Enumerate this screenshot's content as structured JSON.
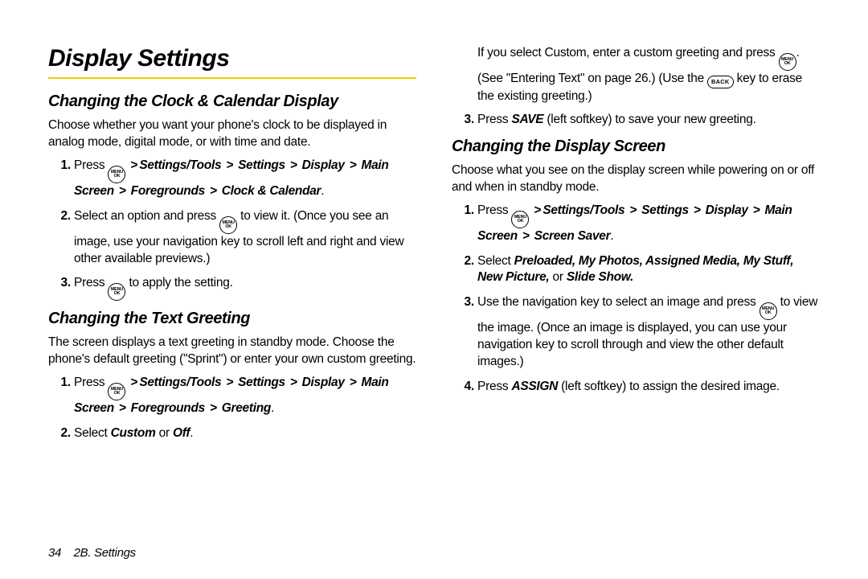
{
  "h1": "Display Settings",
  "sec1": {
    "title": "Changing the Clock & Calendar Display",
    "intro": "Choose whether you want your phone's clock to be displayed in analog mode, digital mode, or with time and date.",
    "step1": {
      "a": "Press",
      "path": "Settings/Tools > Settings > Display > Main Screen > Foregrounds > Clock & Calendar",
      "end": "."
    },
    "step2": {
      "a": "Select an option and press",
      "b": "to view it. (Once you see an image, use your navigation key to scroll left and right and view other available previews.)"
    },
    "step3": {
      "a": "Press",
      "b": "to apply the setting."
    }
  },
  "sec2": {
    "title": "Changing the Text Greeting",
    "intro": "The screen displays a text greeting in standby mode. Choose the phone's default greeting (\"Sprint\") or enter your own custom greeting.",
    "step1": {
      "a": "Press",
      "path": "Settings/Tools > Settings > Display > Main Screen > Foregrounds > Greeting",
      "end": "."
    },
    "step2": {
      "a": "Select",
      "opt1": "Custom",
      "or": "or",
      "opt2": "Off",
      "end": "."
    },
    "cont": {
      "a": "If you select Custom, enter a custom greeting and press",
      "b": ". (See \"Entering Text\" on page 26.) (Use the",
      "c": "key to erase the existing greeting.)"
    },
    "step3": {
      "a": "Press",
      "save": "SAVE",
      "b": "(left softkey) to save your new greeting."
    }
  },
  "sec3": {
    "title": "Changing the Display Screen",
    "intro": "Choose what you see on the display screen while powering on or off and when in standby mode.",
    "step1": {
      "a": "Press",
      "path": "Settings/Tools > Settings > Display > Main Screen > Screen Saver",
      "end": "."
    },
    "step2": {
      "a": "Select",
      "opts": "Preloaded, My Photos, Assigned Media, My Stuff, New Picture,",
      "or": "or",
      "opt_last": "Slide Show.",
      "end": ""
    },
    "step3": {
      "a": "Use the navigation key to select an image and press",
      "b": "to view the image. (Once an image is displayed, you can use your navigation key to scroll through and view the other default images.)"
    },
    "step4": {
      "a": "Press",
      "assign": "ASSIGN",
      "b": "(left softkey) to assign the desired image."
    }
  },
  "keys": {
    "ok_top": "MENU",
    "ok_bottom": "OK",
    "back": "BACK"
  },
  "footer": {
    "page": "34",
    "section": "2B. Settings"
  }
}
